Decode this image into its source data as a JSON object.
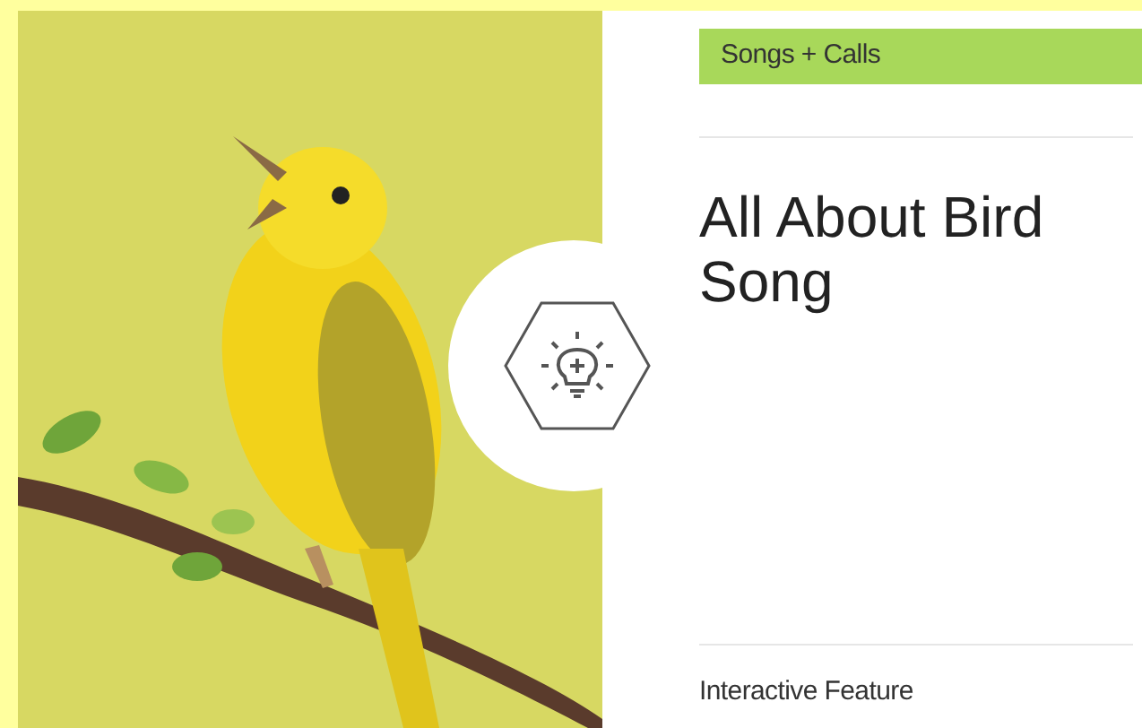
{
  "card": {
    "category": "Songs + Calls",
    "title": "All About Bird Song",
    "type_label": "Interactive Feature"
  }
}
